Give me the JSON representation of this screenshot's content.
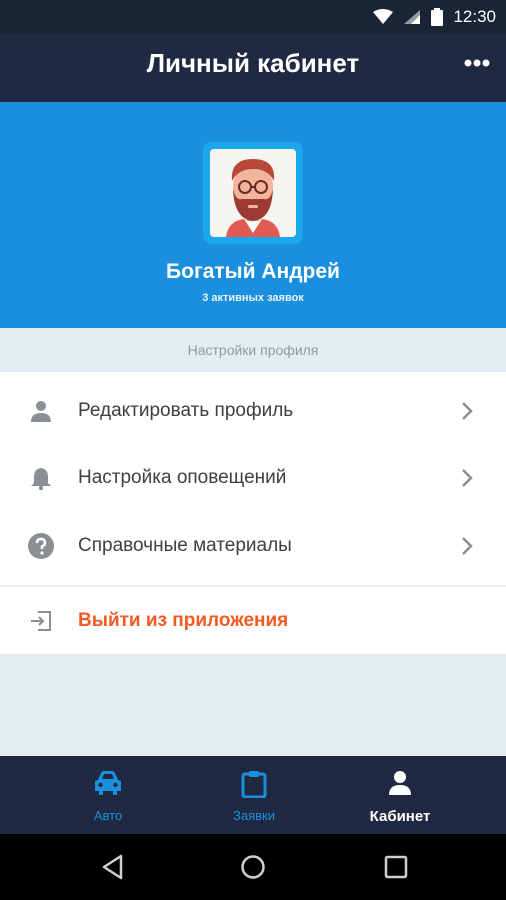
{
  "status_bar": {
    "time": "12:30"
  },
  "app_bar": {
    "title": "Личный кабинет"
  },
  "profile": {
    "name": "Богатый Андрей",
    "subtitle": "3 активных заявок"
  },
  "section": {
    "header": "Настройки профиля"
  },
  "menu": {
    "items": [
      {
        "label": "Редактировать профиль",
        "icon": "person-icon"
      },
      {
        "label": "Настройка оповещений",
        "icon": "bell-icon"
      },
      {
        "label": "Справочные материалы",
        "icon": "help-icon"
      }
    ],
    "logout": {
      "label": "Выйти из приложения",
      "icon": "exit-icon"
    }
  },
  "bottom_nav": {
    "tabs": [
      {
        "label": "Авто",
        "icon": "car-icon",
        "active": false
      },
      {
        "label": "Заявки",
        "icon": "clipboard-icon",
        "active": false
      },
      {
        "label": "Кабинет",
        "icon": "person-icon",
        "active": true
      }
    ]
  },
  "colors": {
    "hero": "#1a8fde",
    "appbar": "#1f2a42",
    "logout": "#f25a22",
    "tab_inactive": "#1a8fde",
    "tab_active": "#ffffff"
  }
}
